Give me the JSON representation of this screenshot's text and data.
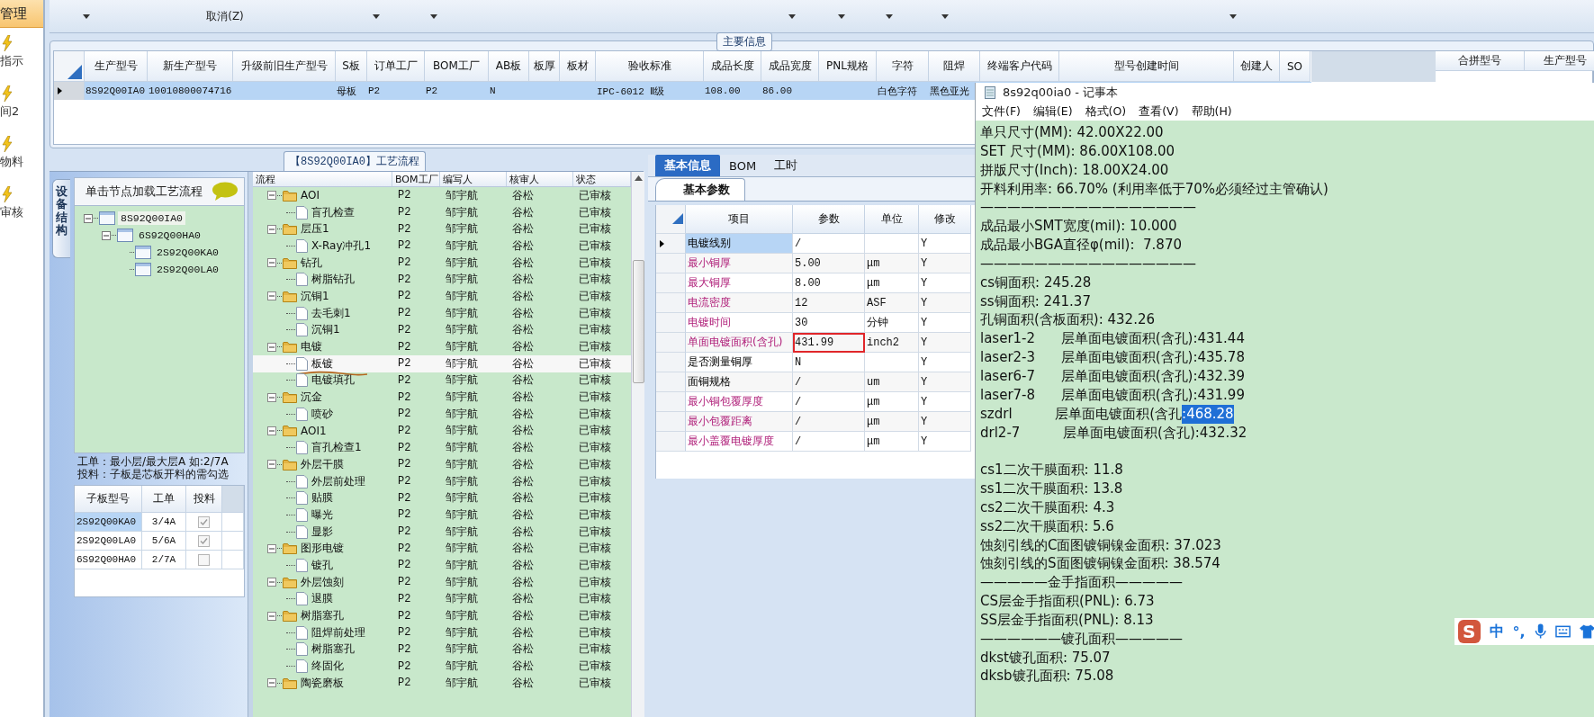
{
  "sidebar": {
    "items": [
      {
        "label": "管理",
        "selected": true
      },
      {
        "label": "指示",
        "selected": false
      },
      {
        "label": "间2",
        "selected": false
      },
      {
        "label": "物料",
        "selected": false
      },
      {
        "label": "审核",
        "selected": false
      }
    ]
  },
  "toolbar": {
    "items": [
      {
        "kind": "dropdown"
      },
      {
        "kind": "button",
        "label": "取消(Z)"
      },
      {
        "kind": "dropdown"
      },
      {
        "kind": "dropdown"
      },
      {
        "kind": "dropdown"
      },
      {
        "kind": "dropdown"
      },
      {
        "kind": "dropdown"
      },
      {
        "kind": "dropdown"
      },
      {
        "kind": "dropdown"
      }
    ]
  },
  "main_info": {
    "title": "主要信息",
    "columns": [
      "生产型号",
      "新生产型号",
      "升级前旧生产型号",
      "S板",
      "订单工厂",
      "BOM工厂",
      "AB板",
      "板厚",
      "板材",
      "验收标准",
      "成品长度",
      "成品宽度",
      "PNL规格",
      "字符",
      "阻焊",
      "终端客户代码",
      "型号创建时间",
      "创建人",
      "SO"
    ],
    "rows": [
      {
        "selected": true,
        "cells": [
          "8S92Q00IA0",
          "10010800074716",
          null,
          "母板",
          "P2",
          "P2",
          "N",
          null,
          null,
          "IPC-6012 Ⅱ级",
          "108.00",
          "86.00",
          null,
          "白色字符",
          "黑色亚光",
          null,
          null,
          null,
          null
        ]
      }
    ],
    "merge_columns": [
      "合拼型号",
      "生产型号"
    ]
  },
  "process_flow": {
    "title": "【8S92Q00IA0】工艺流程",
    "columns": [
      "流程",
      "BOM工厂",
      "编写人",
      "核审人",
      "状态"
    ],
    "rows": [
      {
        "kind": "folder",
        "name": "AOI",
        "factory": "P2",
        "author": "邹宇航",
        "reviewer": "谷松",
        "status": "已审核",
        "expanded": true,
        "selected": false,
        "marked": false,
        "children": [
          {
            "kind": "step",
            "name": "盲孔检查",
            "factory": "P2",
            "author": "邹宇航",
            "reviewer": "谷松",
            "status": "已审核",
            "selected": false,
            "marked": false
          }
        ]
      },
      {
        "kind": "folder",
        "name": "层压1",
        "factory": "P2",
        "author": "邹宇航",
        "reviewer": "谷松",
        "status": "已审核",
        "expanded": true,
        "selected": false,
        "marked": false,
        "children": [
          {
            "kind": "step",
            "name": "X-Ray冲孔1",
            "factory": "P2",
            "author": "邹宇航",
            "reviewer": "谷松",
            "status": "已审核",
            "selected": false,
            "marked": false
          }
        ]
      },
      {
        "kind": "folder",
        "name": "钻孔",
        "factory": "P2",
        "author": "邹宇航",
        "reviewer": "谷松",
        "status": "已审核",
        "expanded": true,
        "selected": false,
        "marked": false,
        "children": [
          {
            "kind": "step",
            "name": "树脂钻孔",
            "factory": "P2",
            "author": "邹宇航",
            "reviewer": "谷松",
            "status": "已审核",
            "selected": false,
            "marked": false
          }
        ]
      },
      {
        "kind": "folder",
        "name": "沉铜1",
        "factory": "P2",
        "author": "邹宇航",
        "reviewer": "谷松",
        "status": "已审核",
        "expanded": true,
        "selected": false,
        "marked": false,
        "children": [
          {
            "kind": "step",
            "name": "去毛刺1",
            "factory": "P2",
            "author": "邹宇航",
            "reviewer": "谷松",
            "status": "已审核",
            "selected": false,
            "marked": false
          },
          {
            "kind": "step",
            "name": "沉铜1",
            "factory": "P2",
            "author": "邹宇航",
            "reviewer": "谷松",
            "status": "已审核",
            "selected": false,
            "marked": false
          }
        ]
      },
      {
        "kind": "folder",
        "name": "电镀",
        "factory": "P2",
        "author": "邹宇航",
        "reviewer": "谷松",
        "status": "已审核",
        "expanded": true,
        "selected": false,
        "marked": false,
        "children": [
          {
            "kind": "step",
            "name": "板镀",
            "factory": "P2",
            "author": "邹宇航",
            "reviewer": "谷松",
            "status": "已审核",
            "selected": true,
            "marked": true
          },
          {
            "kind": "step",
            "name": "电镀填孔",
            "factory": "P2",
            "author": "邹宇航",
            "reviewer": "谷松",
            "status": "已审核",
            "selected": false,
            "marked": false
          }
        ]
      },
      {
        "kind": "folder",
        "name": "沉金",
        "factory": "P2",
        "author": "邹宇航",
        "reviewer": "谷松",
        "status": "已审核",
        "expanded": true,
        "selected": false,
        "marked": false,
        "children": [
          {
            "kind": "step",
            "name": "喷砂",
            "factory": "P2",
            "author": "邹宇航",
            "reviewer": "谷松",
            "status": "已审核",
            "selected": false,
            "marked": false
          }
        ]
      },
      {
        "kind": "folder",
        "name": "AOI1",
        "factory": "P2",
        "author": "邹宇航",
        "reviewer": "谷松",
        "status": "已审核",
        "expanded": true,
        "selected": false,
        "marked": false,
        "children": [
          {
            "kind": "step",
            "name": "盲孔检查1",
            "factory": "P2",
            "author": "邹宇航",
            "reviewer": "谷松",
            "status": "已审核",
            "selected": false,
            "marked": false
          }
        ]
      },
      {
        "kind": "folder",
        "name": "外层干膜",
        "factory": "P2",
        "author": "邹宇航",
        "reviewer": "谷松",
        "status": "已审核",
        "expanded": true,
        "selected": false,
        "marked": false,
        "children": [
          {
            "kind": "step",
            "name": "外层前处理",
            "factory": "P2",
            "author": "邹宇航",
            "reviewer": "谷松",
            "status": "已审核",
            "selected": false,
            "marked": false
          },
          {
            "kind": "step",
            "name": "贴膜",
            "factory": "P2",
            "author": "邹宇航",
            "reviewer": "谷松",
            "status": "已审核",
            "selected": false,
            "marked": false
          },
          {
            "kind": "step",
            "name": "曝光",
            "factory": "P2",
            "author": "邹宇航",
            "reviewer": "谷松",
            "status": "已审核",
            "selected": false,
            "marked": false
          },
          {
            "kind": "step",
            "name": "显影",
            "factory": "P2",
            "author": "邹宇航",
            "reviewer": "谷松",
            "status": "已审核",
            "selected": false,
            "marked": false
          }
        ]
      },
      {
        "kind": "folder",
        "name": "图形电镀",
        "factory": "P2",
        "author": "邹宇航",
        "reviewer": "谷松",
        "status": "已审核",
        "expanded": true,
        "selected": false,
        "marked": false,
        "children": [
          {
            "kind": "step",
            "name": "镀孔",
            "factory": "P2",
            "author": "邹宇航",
            "reviewer": "谷松",
            "status": "已审核",
            "selected": false,
            "marked": false
          }
        ]
      },
      {
        "kind": "folder",
        "name": "外层蚀刻",
        "factory": "P2",
        "author": "邹宇航",
        "reviewer": "谷松",
        "status": "已审核",
        "expanded": true,
        "selected": false,
        "marked": false,
        "children": [
          {
            "kind": "step",
            "name": "退膜",
            "factory": "P2",
            "author": "邹宇航",
            "reviewer": "谷松",
            "status": "已审核",
            "selected": false,
            "marked": false
          }
        ]
      },
      {
        "kind": "folder",
        "name": "树脂塞孔",
        "factory": "P2",
        "author": "邹宇航",
        "reviewer": "谷松",
        "status": "已审核",
        "expanded": true,
        "selected": false,
        "marked": false,
        "children": [
          {
            "kind": "step",
            "name": "阻焊前处理",
            "factory": "P2",
            "author": "邹宇航",
            "reviewer": "谷松",
            "status": "已审核",
            "selected": false,
            "marked": false
          },
          {
            "kind": "step",
            "name": "树脂塞孔",
            "factory": "P2",
            "author": "邹宇航",
            "reviewer": "谷松",
            "status": "已审核",
            "selected": false,
            "marked": false
          },
          {
            "kind": "step",
            "name": "终固化",
            "factory": "P2",
            "author": "邹宇航",
            "reviewer": "谷松",
            "status": "已审核",
            "selected": false,
            "marked": false
          }
        ]
      },
      {
        "kind": "folder",
        "name": "陶瓷磨板",
        "factory": "P2",
        "author": "邹宇航",
        "reviewer": "谷松",
        "status": "已审核",
        "expanded": true,
        "selected": false,
        "marked": false
      }
    ]
  },
  "structure": {
    "tab": "设备结构",
    "header": "单击节点加载工艺流程",
    "tree": [
      {
        "label": "8S92Q00IA0",
        "expanded": true,
        "selected": true,
        "children": [
          {
            "label": "6S92Q00HA0",
            "expanded": true,
            "selected": false,
            "children": [
              {
                "label": "2S92Q00KA0",
                "selected": false
              },
              {
                "label": "2S92Q00LA0",
                "selected": false
              }
            ]
          }
        ]
      }
    ],
    "notes": [
      "工单：最小层/最大层A 如:2/7A",
      "投料：子板是芯板开料的需勾选"
    ],
    "columns": [
      "子板型号",
      "工单",
      "投料"
    ],
    "rows": [
      {
        "model": "2S92Q00KA0",
        "order": "3/4A",
        "feed": true,
        "selected": true
      },
      {
        "model": "2S92Q00LA0",
        "order": "5/6A",
        "feed": true,
        "selected": false
      },
      {
        "model": "6S92Q00HA0",
        "order": "2/7A",
        "feed": false,
        "selected": false
      }
    ]
  },
  "params": {
    "tabs": [
      {
        "label": "基本信息",
        "selected": true
      },
      {
        "label": "BOM",
        "selected": false
      },
      {
        "label": "工时",
        "selected": false
      }
    ],
    "subtab": "基本参数",
    "columns": [
      "项目",
      "参数",
      "单位",
      "修改"
    ],
    "rows": [
      {
        "item": "电镀线别",
        "required": false,
        "value": "/",
        "unit": null,
        "modify": "Y",
        "selected": true,
        "annotated": false
      },
      {
        "item": "最小铜厚",
        "required": true,
        "value": "5.00",
        "unit": "μm",
        "modify": "Y",
        "selected": false,
        "annotated": false
      },
      {
        "item": "最大铜厚",
        "required": true,
        "value": "8.00",
        "unit": "μm",
        "modify": "Y",
        "selected": false,
        "annotated": false
      },
      {
        "item": "电流密度",
        "required": true,
        "value": "12",
        "unit": "ASF",
        "modify": "Y",
        "selected": false,
        "annotated": false
      },
      {
        "item": "电镀时间",
        "required": true,
        "value": "30",
        "unit": "分钟",
        "modify": "Y",
        "selected": false,
        "annotated": false
      },
      {
        "item": "单面电镀面积(含孔)",
        "required": true,
        "value": "431.99",
        "unit": "inch2",
        "modify": "Y",
        "selected": false,
        "annotated": true
      },
      {
        "item": "是否测量铜厚",
        "required": false,
        "value": "N",
        "unit": null,
        "modify": "Y",
        "selected": false,
        "annotated": false
      },
      {
        "item": "面铜规格",
        "required": false,
        "value": "/",
        "unit": "um",
        "modify": "Y",
        "selected": false,
        "annotated": false
      },
      {
        "item": "最小铜包覆厚度",
        "required": true,
        "value": "/",
        "unit": "μm",
        "modify": "Y",
        "selected": false,
        "annotated": false
      },
      {
        "item": "最小包覆距离",
        "required": true,
        "value": "/",
        "unit": "μm",
        "modify": "Y",
        "selected": false,
        "annotated": false
      },
      {
        "item": "最小盖覆电镀厚度",
        "required": true,
        "value": "/",
        "unit": "μm",
        "modify": "Y",
        "selected": false,
        "annotated": false
      }
    ]
  },
  "notepad": {
    "title": "8s92q00ia0 - 记事本",
    "menu": [
      "文件(F)",
      "编辑(E)",
      "格式(O)",
      "查看(V)",
      "帮助(H)"
    ],
    "lines": [
      {
        "kind": "text",
        "text": "单只尺寸(MM): 42.00X22.00"
      },
      {
        "kind": "text",
        "text": "SET 尺寸(MM): 86.00X108.00"
      },
      {
        "kind": "text",
        "text": "拼版尺寸(Inch): 18.00X24.00"
      },
      {
        "kind": "text",
        "text": "开料利用率: 66.70% (利用率低于70%必须经过主管确认)"
      },
      {
        "kind": "text",
        "text": "————————————————"
      },
      {
        "kind": "text",
        "text": "成品最小SMT宽度(mil): 10.000"
      },
      {
        "kind": "text",
        "text": "成品最小BGA直径φ(mil):  7.870"
      },
      {
        "kind": "text",
        "text": "————————————————"
      },
      {
        "kind": "text",
        "text": "cs铜面积: 245.28"
      },
      {
        "kind": "text",
        "text": "ss铜面积: 241.37"
      },
      {
        "kind": "text",
        "text": "孔铜面积(含板面积): 432.26"
      },
      {
        "kind": "text",
        "text": "laser1-2      层单面电镀面积(含孔):431.44"
      },
      {
        "kind": "text",
        "text": "laser2-3      层单面电镀面积(含孔):435.78"
      },
      {
        "kind": "text",
        "text": "laser6-7      层单面电镀面积(含孔):432.39"
      },
      {
        "kind": "text",
        "text": "laser7-8      层单面电镀面积(含孔):431.99"
      },
      {
        "kind": "text",
        "text": "szdrl          层单面电镀面积(含孔",
        "selected_text": ":468.28"
      },
      {
        "kind": "text",
        "text": "drl2-7          层单面电镀面积(含孔):432.32"
      },
      {
        "kind": "blank"
      },
      {
        "kind": "text",
        "text": "cs1二次干膜面积: 11.8"
      },
      {
        "kind": "text",
        "text": "ss1二次干膜面积: 13.8"
      },
      {
        "kind": "text",
        "text": "cs2二次干膜面积: 4.3"
      },
      {
        "kind": "text",
        "text": "ss2二次干膜面积: 5.6"
      },
      {
        "kind": "text",
        "text": "蚀刻引线的C面图镀铜镍金面积: 37.023"
      },
      {
        "kind": "text",
        "text": "蚀刻引线的S面图镀铜镍金面积: 38.574"
      },
      {
        "kind": "text",
        "text": "—————金手指面积—————"
      },
      {
        "kind": "text",
        "text": "CS层金手指面积(PNL): 6.73"
      },
      {
        "kind": "text",
        "text": "SS层金手指面积(PNL): 8.13"
      },
      {
        "kind": "text",
        "text": "——————镀孔面积—————"
      },
      {
        "kind": "text",
        "text": "dkst镀孔面积: 75.07"
      },
      {
        "kind": "text",
        "text": "dksb镀孔面积: 75.08"
      }
    ]
  },
  "ime": {
    "logo": "S",
    "mode": "中",
    "punct": "°,"
  }
}
